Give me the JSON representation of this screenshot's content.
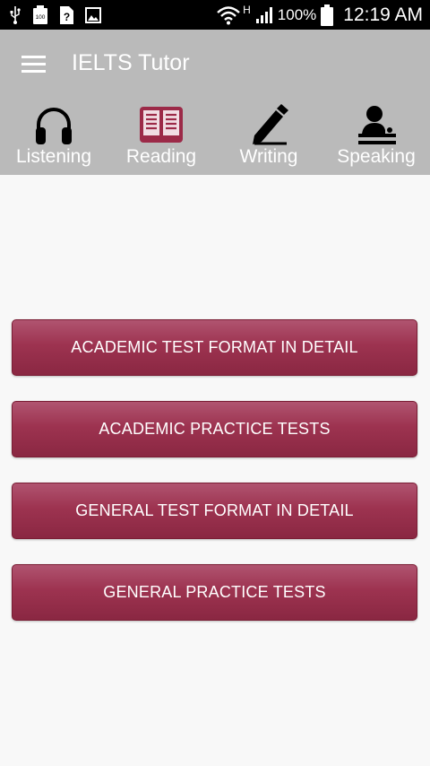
{
  "status_bar": {
    "network_type": "H",
    "battery_percent": "100%",
    "time": "12:19 AM"
  },
  "app_bar": {
    "title": "IELTS Tutor"
  },
  "tabs": [
    {
      "label": "Listening",
      "icon": "headphones-icon"
    },
    {
      "label": "Reading",
      "icon": "book-icon",
      "selected": true
    },
    {
      "label": "Writing",
      "icon": "pen-icon"
    },
    {
      "label": "Speaking",
      "icon": "speaker-icon"
    }
  ],
  "buttons": [
    {
      "label": "ACADEMIC TEST FORMAT IN DETAIL"
    },
    {
      "label": "ACADEMIC PRACTICE TESTS"
    },
    {
      "label": "GENERAL TEST FORMAT IN DETAIL"
    },
    {
      "label": "GENERAL PRACTICE TESTS"
    }
  ],
  "colors": {
    "app_bar": "#bababa",
    "accent": "#9d3350",
    "selected_icon": "#9c2a48"
  }
}
